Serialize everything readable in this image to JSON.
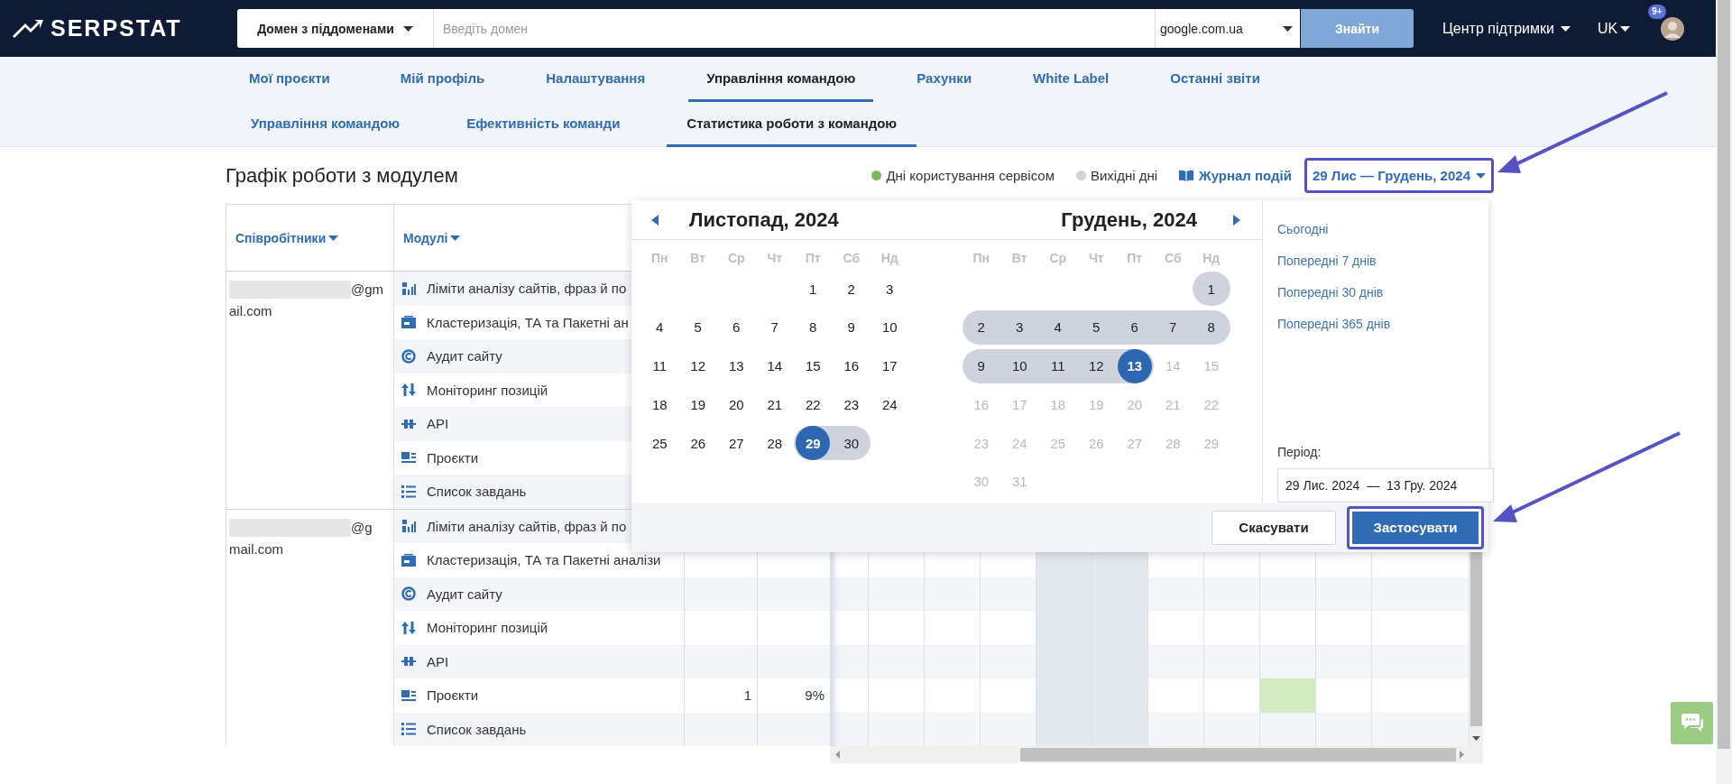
{
  "header": {
    "logo": "SERPSTAT",
    "search_mode": "Домен з піддоменами",
    "search": {
      "placeholder": "Введіть домен"
    },
    "engine": "google.com.ua",
    "search_button": {
      "label": "Знайти",
      "disabled": true
    },
    "support": "Центр підтримки",
    "language": "UK",
    "notifications_badge": "9+"
  },
  "nav_tabs": [
    {
      "label": "Мої проєкти",
      "selected": false
    },
    {
      "label": "Мій профіль",
      "selected": false
    },
    {
      "label": "Налаштування",
      "selected": false
    },
    {
      "label": "Управління командою",
      "selected": true
    },
    {
      "label": "Рахунки",
      "selected": false
    },
    {
      "label": "White Label",
      "selected": false
    },
    {
      "label": "Останні звіти",
      "selected": false
    }
  ],
  "sub_tabs": [
    {
      "label": "Управління командою",
      "selected": false
    },
    {
      "label": "Ефективність команди",
      "selected": false
    },
    {
      "label": "Статистика роботи з командою",
      "selected": true
    }
  ],
  "page_title": "Графік роботи з модулем",
  "legend": [
    {
      "label": "Дні користування сервісом",
      "color": "#7cb65a"
    },
    {
      "label": "Вихідні дні",
      "color": "#cfd3dc"
    }
  ],
  "event_log": "Журнал подій",
  "date_range": {
    "label": "29 Лис — Грудень, 2024",
    "highlighted": true
  },
  "table": {
    "columns": [
      "Співробітники",
      "Модулі"
    ],
    "day_columns": [
      {
        "weekend": false
      },
      {
        "weekend": false
      },
      {
        "weekend": false
      },
      {
        "weekend": false
      },
      {
        "weekend": true
      },
      {
        "weekend": true
      },
      {
        "weekend": false
      },
      {
        "weekend": false
      },
      {
        "weekend": false
      },
      {
        "weekend": false
      },
      {
        "weekend": false
      }
    ],
    "users": [
      {
        "email": [
          "@gm",
          "ail.com"
        ],
        "rows": [
          {
            "module": "Ліміти аналізу сайтів, фраз й по"
          },
          {
            "module": "Кластеризація, ТА та Пакетні ан"
          },
          {
            "module": "Аудит сайту"
          },
          {
            "module": "Моніторинг позицій"
          },
          {
            "module": "API"
          },
          {
            "module": "Проєкти"
          },
          {
            "module": "Список завдань"
          }
        ]
      },
      {
        "email": [
          "@g",
          "mail.com"
        ],
        "rows": [
          {
            "module": "Ліміти аналізу сайтів, фраз й по"
          },
          {
            "module": "Кластеризація, ТА та Пакетні аналізи"
          },
          {
            "module": "Аудит сайту"
          },
          {
            "module": "Моніторинг позицій"
          },
          {
            "module": "API"
          },
          {
            "module": "Проєкти",
            "count": "1",
            "percent": "9%",
            "days": [
              false,
              false,
              false,
              false,
              false,
              false,
              false,
              false,
              true,
              false,
              false
            ]
          },
          {
            "module": "Список завдань"
          }
        ]
      }
    ]
  },
  "calendar": {
    "months": [
      {
        "title": "Листопад, 2024",
        "weekdays": [
          "Пн",
          "Вт",
          "Ср",
          "Чт",
          "Пт",
          "Сб",
          "Нд"
        ],
        "weeks": [
          [
            {
              "kind": "empty"
            },
            {
              "kind": "empty"
            },
            {
              "kind": "empty"
            },
            {
              "kind": "empty"
            },
            {
              "kind": "day",
              "label": "1",
              "in_range": false,
              "selected": false,
              "disabled": false
            },
            {
              "kind": "day",
              "label": "2",
              "in_range": false,
              "selected": false,
              "disabled": false
            },
            {
              "kind": "day",
              "label": "3",
              "in_range": false,
              "selected": false,
              "disabled": false
            }
          ],
          [
            {
              "kind": "day",
              "label": "4",
              "in_range": false,
              "selected": false,
              "disabled": false
            },
            {
              "kind": "day",
              "label": "5",
              "in_range": false,
              "selected": false,
              "disabled": false
            },
            {
              "kind": "day",
              "label": "6",
              "in_range": false,
              "selected": false,
              "disabled": false
            },
            {
              "kind": "day",
              "label": "7",
              "in_range": false,
              "selected": false,
              "disabled": false
            },
            {
              "kind": "day",
              "label": "8",
              "in_range": false,
              "selected": false,
              "disabled": false
            },
            {
              "kind": "day",
              "label": "9",
              "in_range": false,
              "selected": false,
              "disabled": false
            },
            {
              "kind": "day",
              "label": "10",
              "in_range": false,
              "selected": false,
              "disabled": false
            }
          ],
          [
            {
              "kind": "day",
              "label": "11",
              "in_range": false,
              "selected": false,
              "disabled": false
            },
            {
              "kind": "day",
              "label": "12",
              "in_range": false,
              "selected": false,
              "disabled": false
            },
            {
              "kind": "day",
              "label": "13",
              "in_range": false,
              "selected": false,
              "disabled": false
            },
            {
              "kind": "day",
              "label": "14",
              "in_range": false,
              "selected": false,
              "disabled": false
            },
            {
              "kind": "day",
              "label": "15",
              "in_range": false,
              "selected": false,
              "disabled": false
            },
            {
              "kind": "day",
              "label": "16",
              "in_range": false,
              "selected": false,
              "disabled": false
            },
            {
              "kind": "day",
              "label": "17",
              "in_range": false,
              "selected": false,
              "disabled": false
            }
          ],
          [
            {
              "kind": "day",
              "label": "18",
              "in_range": false,
              "selected": false,
              "disabled": false
            },
            {
              "kind": "day",
              "label": "19",
              "in_range": false,
              "selected": false,
              "disabled": false
            },
            {
              "kind": "day",
              "label": "20",
              "in_range": false,
              "selected": false,
              "disabled": false
            },
            {
              "kind": "day",
              "label": "21",
              "in_range": false,
              "selected": false,
              "disabled": false
            },
            {
              "kind": "day",
              "label": "22",
              "in_range": false,
              "selected": false,
              "disabled": false
            },
            {
              "kind": "day",
              "label": "23",
              "in_range": false,
              "selected": false,
              "disabled": false
            },
            {
              "kind": "day",
              "label": "24",
              "in_range": false,
              "selected": false,
              "disabled": false
            }
          ],
          [
            {
              "kind": "day",
              "label": "25",
              "in_range": false,
              "selected": false,
              "disabled": false
            },
            {
              "kind": "day",
              "label": "26",
              "in_range": false,
              "selected": false,
              "disabled": false
            },
            {
              "kind": "day",
              "label": "27",
              "in_range": false,
              "selected": false,
              "disabled": false
            },
            {
              "kind": "day",
              "label": "28",
              "in_range": false,
              "selected": false,
              "disabled": false
            },
            {
              "kind": "day",
              "label": "29",
              "in_range": true,
              "selected": true,
              "disabled": false
            },
            {
              "kind": "day",
              "label": "30",
              "in_range": true,
              "selected": false,
              "disabled": false
            }
          ]
        ]
      },
      {
        "title": "Грудень, 2024",
        "weekdays": [
          "Пн",
          "Вт",
          "Ср",
          "Чт",
          "Пт",
          "Сб",
          "Нд"
        ],
        "weeks": [
          [
            {
              "kind": "empty"
            },
            {
              "kind": "empty"
            },
            {
              "kind": "empty"
            },
            {
              "kind": "empty"
            },
            {
              "kind": "empty"
            },
            {
              "kind": "empty"
            },
            {
              "kind": "day",
              "label": "1",
              "in_range": true,
              "selected": false,
              "disabled": false
            }
          ],
          [
            {
              "kind": "day",
              "label": "2",
              "in_range": true,
              "selected": false,
              "disabled": false
            },
            {
              "kind": "day",
              "label": "3",
              "in_range": true,
              "selected": false,
              "disabled": false
            },
            {
              "kind": "day",
              "label": "4",
              "in_range": true,
              "selected": false,
              "disabled": false
            },
            {
              "kind": "day",
              "label": "5",
              "in_range": true,
              "selected": false,
              "disabled": false
            },
            {
              "kind": "day",
              "label": "6",
              "in_range": true,
              "selected": false,
              "disabled": false
            },
            {
              "kind": "day",
              "label": "7",
              "in_range": true,
              "selected": false,
              "disabled": false
            },
            {
              "kind": "day",
              "label": "8",
              "in_range": true,
              "selected": false,
              "disabled": false
            }
          ],
          [
            {
              "kind": "day",
              "label": "9",
              "in_range": true,
              "selected": false,
              "disabled": false
            },
            {
              "kind": "day",
              "label": "10",
              "in_range": true,
              "selected": false,
              "disabled": false
            },
            {
              "kind": "day",
              "label": "11",
              "in_range": true,
              "selected": false,
              "disabled": false
            },
            {
              "kind": "day",
              "label": "12",
              "in_range": true,
              "selected": false,
              "disabled": false
            },
            {
              "kind": "day",
              "label": "13",
              "in_range": true,
              "selected": true,
              "disabled": false
            },
            {
              "kind": "day",
              "label": "14",
              "in_range": false,
              "selected": false,
              "disabled": true
            },
            {
              "kind": "day",
              "label": "15",
              "in_range": false,
              "selected": false,
              "disabled": true
            }
          ],
          [
            {
              "kind": "day",
              "label": "16",
              "in_range": false,
              "selected": false,
              "disabled": true
            },
            {
              "kind": "day",
              "label": "17",
              "in_range": false,
              "selected": false,
              "disabled": true
            },
            {
              "kind": "day",
              "label": "18",
              "in_range": false,
              "selected": false,
              "disabled": true
            },
            {
              "kind": "day",
              "label": "19",
              "in_range": false,
              "selected": false,
              "disabled": true
            },
            {
              "kind": "day",
              "label": "20",
              "in_range": false,
              "selected": false,
              "disabled": true
            },
            {
              "kind": "day",
              "label": "21",
              "in_range": false,
              "selected": false,
              "disabled": true
            },
            {
              "kind": "day",
              "label": "22",
              "in_range": false,
              "selected": false,
              "disabled": true
            }
          ],
          [
            {
              "kind": "day",
              "label": "23",
              "in_range": false,
              "selected": false,
              "disabled": true
            },
            {
              "kind": "day",
              "label": "24",
              "in_range": false,
              "selected": false,
              "disabled": true
            },
            {
              "kind": "day",
              "label": "25",
              "in_range": false,
              "selected": false,
              "disabled": true
            },
            {
              "kind": "day",
              "label": "26",
              "in_range": false,
              "selected": false,
              "disabled": true
            },
            {
              "kind": "day",
              "label": "27",
              "in_range": false,
              "selected": false,
              "disabled": true
            },
            {
              "kind": "day",
              "label": "28",
              "in_range": false,
              "selected": false,
              "disabled": true
            },
            {
              "kind": "day",
              "label": "29",
              "in_range": false,
              "selected": false,
              "disabled": true
            }
          ],
          [
            {
              "kind": "day",
              "label": "30",
              "in_range": false,
              "selected": false,
              "disabled": true
            },
            {
              "kind": "day",
              "label": "31",
              "in_range": false,
              "selected": false,
              "disabled": true
            }
          ]
        ]
      }
    ],
    "presets": [
      "Сьогодні",
      "Попередні 7 днів",
      "Попередні 30 днів",
      "Попередні 365 днів"
    ],
    "period_label": "Період:",
    "period_value": "29 Лис. 2024  —  13 Гру. 2024",
    "cancel": "Скасувати",
    "apply": {
      "label": "Застосувати",
      "highlighted": true
    }
  }
}
